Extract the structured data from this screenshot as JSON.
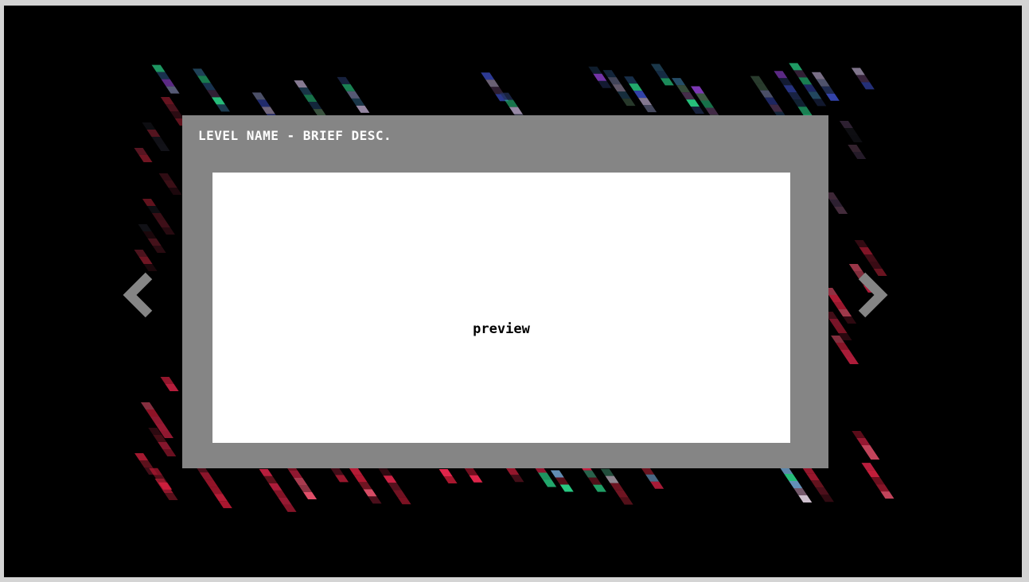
{
  "level": {
    "title": "LEVEL NAME - BRIEF DESC.",
    "preview_label": "preview"
  },
  "navigation": {
    "prev_icon": "chevron-left-icon",
    "next_icon": "chevron-right-icon"
  },
  "colors": {
    "background": "#000000",
    "panel": "#858585",
    "preview": "#ffffff",
    "arrow": "#858585",
    "accent_red": "#ff2a55",
    "accent_green": "#2bd68a",
    "accent_blue": "#3a6df0",
    "accent_purple": "#8a3ec8"
  }
}
